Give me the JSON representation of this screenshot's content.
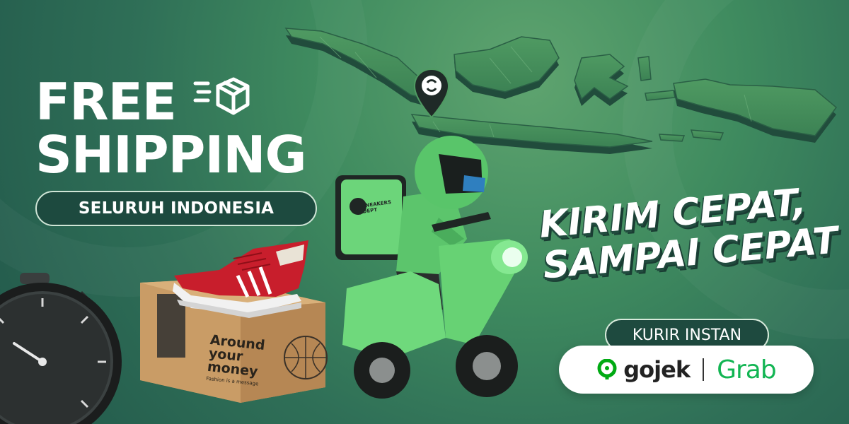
{
  "headline": {
    "line1": "FREE",
    "line2": "SHIPPING"
  },
  "region_pill": "SELURUH INDONESIA",
  "slogan": {
    "line1": "KIRIM CEPAT,",
    "line2": "SAMPAI CEPAT"
  },
  "courier": {
    "label": "KURIR INSTAN",
    "gojek": "gojek",
    "grab": "Grab"
  },
  "box": {
    "brand_line1": "Around",
    "brand_line2": "your",
    "brand_line3": "money",
    "tagline": "Fashion is a message"
  },
  "backpack_brand": "SNEAKERS DEPT",
  "colors": {
    "background": "#2f6f57",
    "accent_green": "#5fd06b",
    "grab_green": "#12b553",
    "pill_dark": "#1d4a3f"
  }
}
